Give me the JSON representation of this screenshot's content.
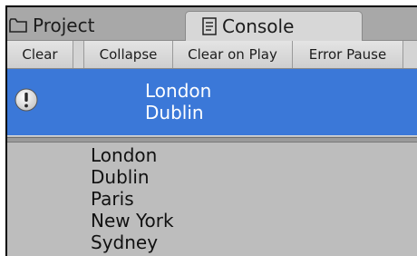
{
  "tabs": {
    "project_label": "Project",
    "console_label": "Console"
  },
  "toolbar": {
    "clear_label": "Clear",
    "collapse_label": "Collapse",
    "clear_on_play_label": "Clear on Play",
    "error_pause_label": "Error Pause"
  },
  "log": {
    "selected_entry": {
      "icon": "info-icon",
      "line1": "London",
      "line2": "Dublin"
    }
  },
  "detail": {
    "lines": [
      "London",
      "Dublin",
      "Paris",
      "New York",
      "Sydney"
    ]
  },
  "colors": {
    "selection": "#3b78d8",
    "window_bg": "#bdbdbd",
    "toolbar_bg": "#d4d4d4"
  }
}
